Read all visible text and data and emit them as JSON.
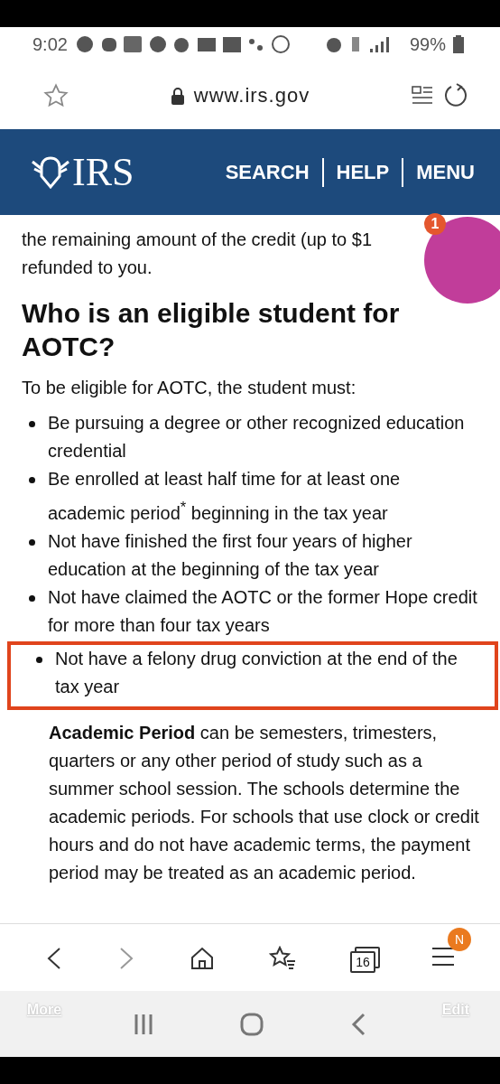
{
  "status_bar": {
    "time": "9:02",
    "battery": "99%"
  },
  "browser": {
    "url": "www.irs.gov"
  },
  "header": {
    "logo": "IRS",
    "nav": [
      {
        "label": "SEARCH"
      },
      {
        "label": "HELP"
      },
      {
        "label": "MENU"
      }
    ]
  },
  "article": {
    "intro_lines": [
      "the remaining amount of the credit (up to $1",
      "refunded to you."
    ],
    "heading": "Who is an eligible student for AOTC?",
    "lead": "To be eligible for AOTC, the student must:",
    "bullets": [
      {
        "text": "Be pursuing a degree or other recognized education credential",
        "highlighted": false
      },
      {
        "text": "Be enrolled at least half time for at least one academic period$^{*}$ beginning in the tax year",
        "highlighted": false
      },
      {
        "text": "Not have finished the first four years of higher education at the beginning of the tax year",
        "highlighted": false
      },
      {
        "text": "Not have claimed the AOTC or the former Hope credit for more than four tax years",
        "highlighted": false
      },
      {
        "text": "Not have a felony drug conviction at the end of the tax year",
        "highlighted": true
      }
    ],
    "footnote": "**Academic Period** can be semesters, trimesters, quarters or any other period of study such as a summer school session. The schools determine the academic periods. For schools that use clock or credit hours and do not have academic terms, the payment period may be treated as an academic period."
  },
  "chat_bubble": {
    "badge": "1"
  },
  "toolbar": {
    "tabs_count": "16",
    "menu_badge": "N"
  },
  "overlay": {
    "left": "More",
    "right": "Edit"
  }
}
